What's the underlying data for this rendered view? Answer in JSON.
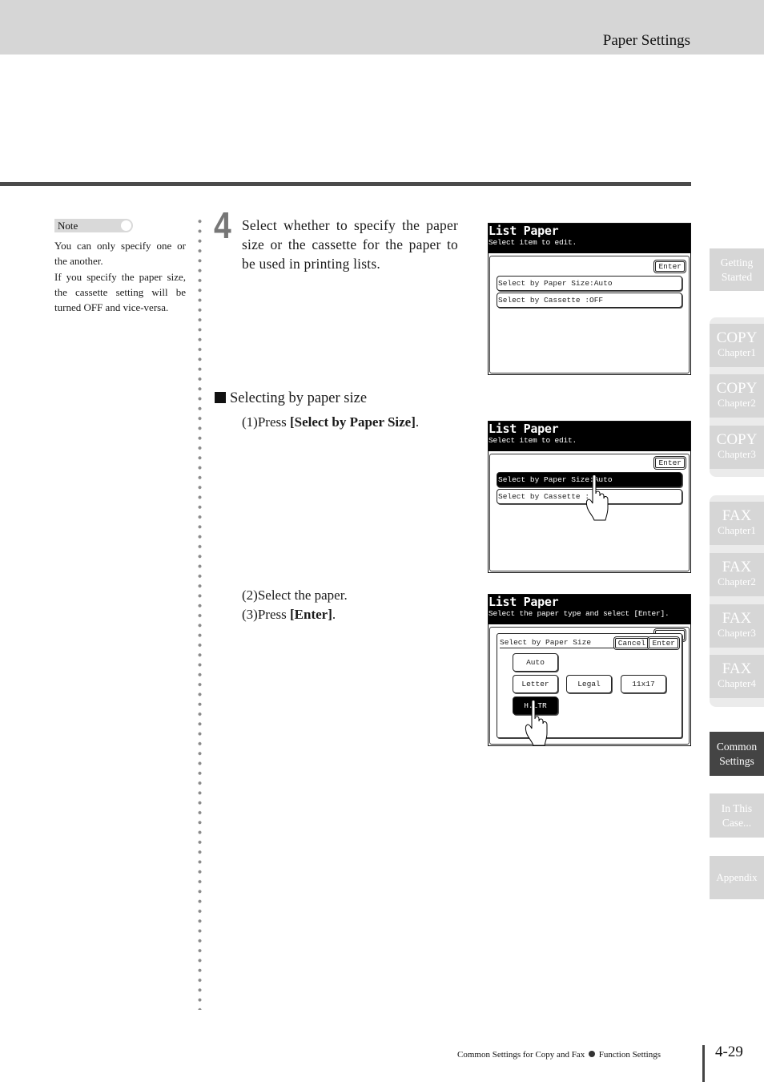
{
  "header": {
    "section_title": "Paper Settings"
  },
  "note": {
    "label": "Note",
    "lines": [
      "You can only specify one or the another.",
      "If you specify the paper size, the cassette setting will be turned OFF and vice-versa."
    ]
  },
  "step": {
    "number": "4",
    "text": "Select whether to specify the paper size or the cassette for the paper to be used in printing lists."
  },
  "subsection": {
    "heading": "Selecting by paper size",
    "substeps": [
      {
        "num": "(1)",
        "prefix": "Press ",
        "bold": "[Select by Paper Size]",
        "suffix": "."
      },
      {
        "num": "(2)",
        "prefix": "Select the paper.",
        "bold": "",
        "suffix": ""
      },
      {
        "num": "(3)",
        "prefix": "Press ",
        "bold": "[Enter]",
        "suffix": "."
      }
    ]
  },
  "screens": [
    {
      "title": "List Paper",
      "subtitle": "Select item to edit.",
      "enter_label": "Enter",
      "items": [
        {
          "label": "Select by Paper Size:Auto",
          "selected": false
        },
        {
          "label": "Select by Cassette  :OFF",
          "selected": false
        }
      ]
    },
    {
      "title": "List Paper",
      "subtitle": "Select item to edit.",
      "enter_label": "Enter",
      "items": [
        {
          "label": "Select by Paper Size:Auto",
          "selected": true
        },
        {
          "label": "Select by Cassette  :",
          "selected": false
        }
      ]
    },
    {
      "title": "List Paper",
      "subtitle": "Select the paper type and select [Enter].",
      "dialog_title": "Select by Paper Size",
      "cancel_label": "Cancel",
      "enter_label": "Enter",
      "papers": [
        {
          "label": "Auto",
          "selected": false
        },
        {
          "label": "Letter",
          "selected": false
        },
        {
          "label": "Legal",
          "selected": false
        },
        {
          "label": "11x17",
          "selected": false
        },
        {
          "label": "H.LTR",
          "selected": true
        }
      ]
    }
  ],
  "side_tabs": [
    {
      "main": "Getting",
      "sub": "Started",
      "style": "two",
      "active": false
    },
    {
      "main": "COPY",
      "sub": "Chapter1",
      "style": "chapter",
      "active": false
    },
    {
      "main": "COPY",
      "sub": "Chapter2",
      "style": "chapter",
      "active": false
    },
    {
      "main": "COPY",
      "sub": "Chapter3",
      "style": "chapter",
      "active": false
    },
    {
      "main": "FAX",
      "sub": "Chapter1",
      "style": "chapter",
      "active": false
    },
    {
      "main": "FAX",
      "sub": "Chapter2",
      "style": "chapter",
      "active": false
    },
    {
      "main": "FAX",
      "sub": "Chapter3",
      "style": "chapter",
      "active": false
    },
    {
      "main": "FAX",
      "sub": "Chapter4",
      "style": "chapter",
      "active": false
    },
    {
      "main": "Common",
      "sub": "Settings",
      "style": "two",
      "active": true
    },
    {
      "main": "In This",
      "sub": "Case...",
      "style": "two",
      "active": false
    },
    {
      "main": "Appendix",
      "sub": "",
      "style": "single",
      "active": false
    }
  ],
  "footer": {
    "left": "Common Settings for Copy and Fax",
    "right": "Function Settings",
    "page_number": "4-29"
  }
}
